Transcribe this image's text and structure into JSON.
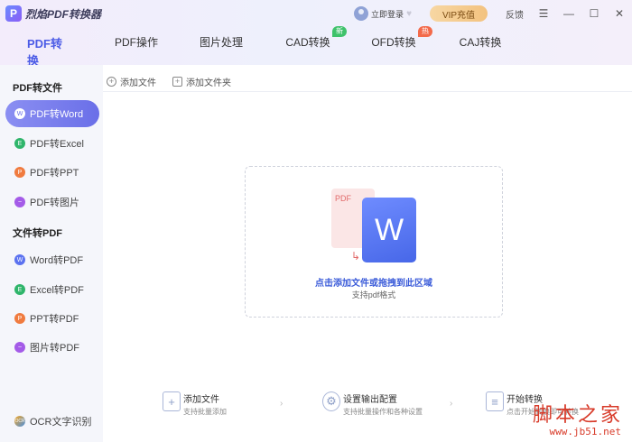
{
  "app": {
    "logo_letter": "P",
    "title": "烈焰PDF转换器"
  },
  "header": {
    "login_label": "立即登录",
    "vip_label": "VIP充值",
    "feedback_label": "反馈",
    "menu_glyph": "☰",
    "minimize_glyph": "—",
    "maximize_glyph": "☐",
    "close_glyph": "✕"
  },
  "tabs": [
    {
      "label": "PDF转换",
      "active": true
    },
    {
      "label": "PDF操作"
    },
    {
      "label": "图片处理"
    },
    {
      "label": "CAD转换",
      "badge": "新"
    },
    {
      "label": "OFD转换",
      "badge": "热"
    },
    {
      "label": "CAJ转换"
    }
  ],
  "sidebar": {
    "section1_title": "PDF转文件",
    "section1_items": [
      {
        "label": "PDF转Word",
        "icon": "word-icon",
        "icon_glyph": "W",
        "color": "#5b72f0"
      },
      {
        "label": "PDF转Excel",
        "icon": "excel-icon",
        "icon_glyph": "E",
        "color": "#2fb56b"
      },
      {
        "label": "PDF转PPT",
        "icon": "ppt-icon",
        "icon_glyph": "P",
        "color": "#f07b3f"
      },
      {
        "label": "PDF转图片",
        "icon": "image-icon",
        "icon_glyph": "~",
        "color": "#a45be8"
      }
    ],
    "section2_title": "文件转PDF",
    "section2_items": [
      {
        "label": "Word转PDF",
        "icon": "word-icon",
        "icon_glyph": "W",
        "color": "#5b72f0"
      },
      {
        "label": "Excel转PDF",
        "icon": "excel-icon",
        "icon_glyph": "E",
        "color": "#2fb56b"
      },
      {
        "label": "PPT转PDF",
        "icon": "ppt-icon",
        "icon_glyph": "P",
        "color": "#f07b3f"
      },
      {
        "label": "图片转PDF",
        "icon": "image-icon",
        "icon_glyph": "~",
        "color": "#a45be8"
      }
    ],
    "ocr_label": "OCR文字识别",
    "ocr_glyph": "OCR"
  },
  "toolbar": {
    "add_file_label": "添加文件",
    "add_folder_label": "添加文件夹"
  },
  "dropzone": {
    "pdf_label": "PDF",
    "word_letter": "W",
    "main_text": "点击添加文件或拖拽到此区域",
    "sub_text": "支持pdf格式"
  },
  "steps": [
    {
      "title": "添加文件",
      "desc": "支持批量添加",
      "icon": "add-file-icon",
      "glyph": "+"
    },
    {
      "title": "设置输出配置",
      "desc": "支持批量操作和各种设置",
      "icon": "gear-icon",
      "glyph": "⚙"
    },
    {
      "title": "开始转换",
      "desc": "点击开始转换即可转换",
      "icon": "document-icon",
      "glyph": "≡"
    }
  ],
  "step_arrow": "›",
  "watermark": {
    "text": "脚本之家",
    "url": "www.jb51.net"
  },
  "colors": {
    "accent": "#4b5be6",
    "vip": "#f3c27f",
    "watermark": "#d83b2a"
  }
}
